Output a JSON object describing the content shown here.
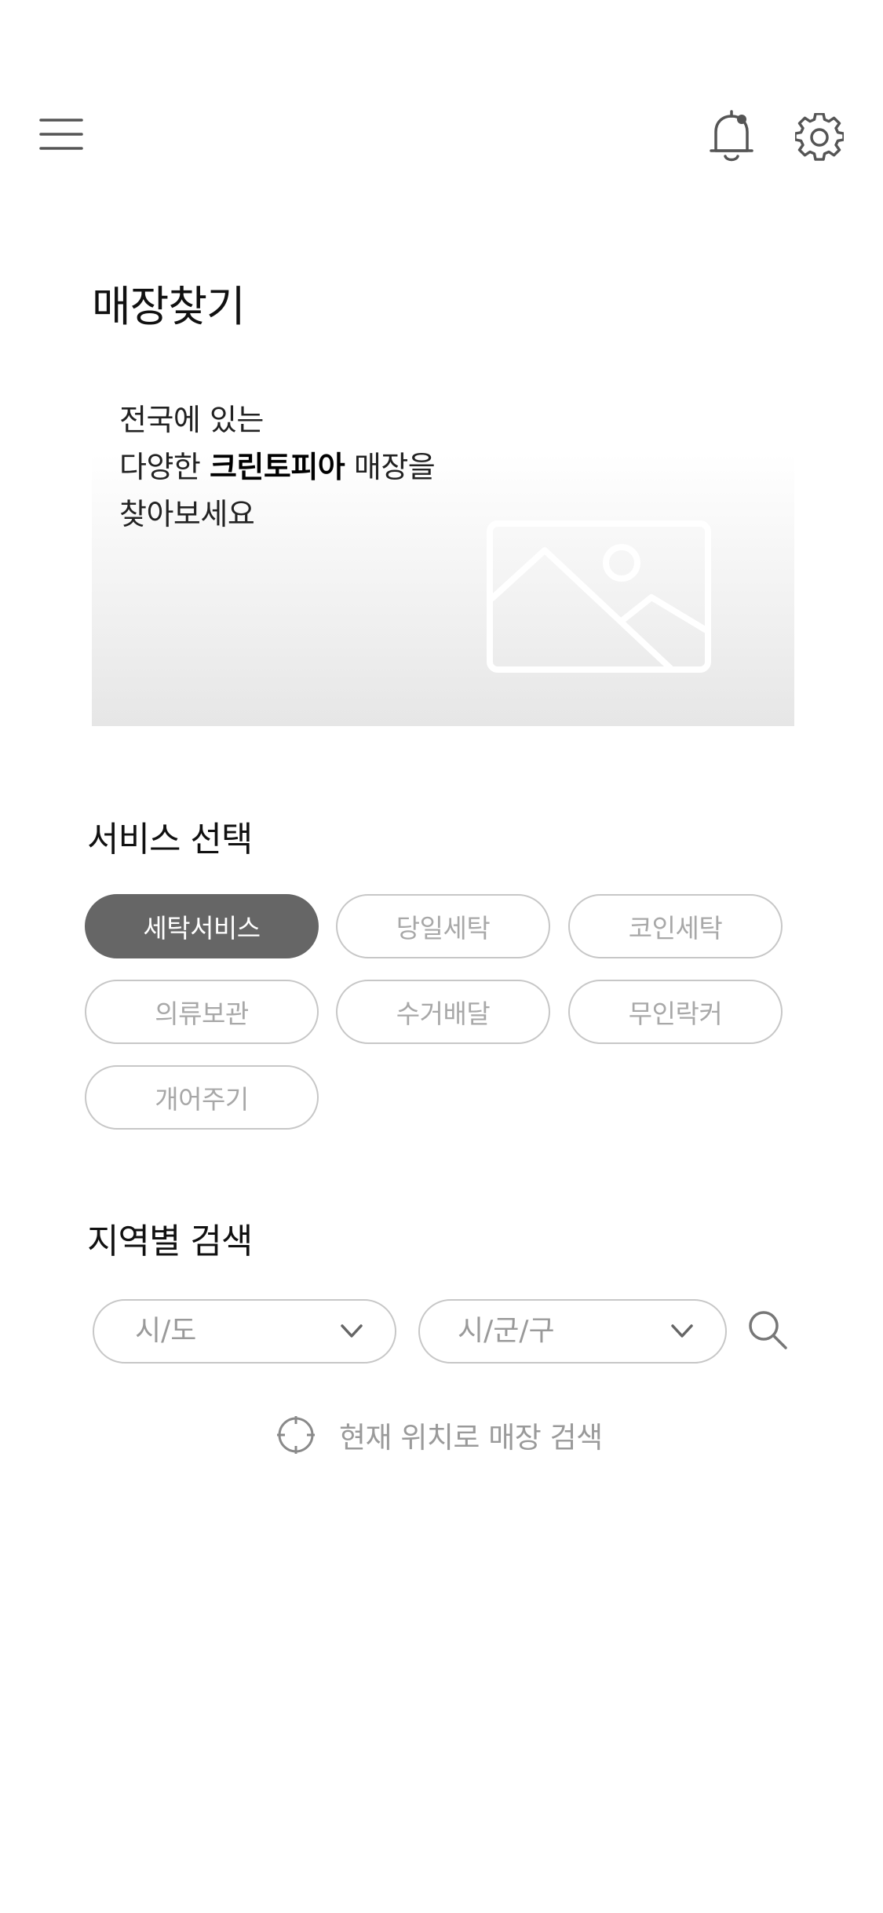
{
  "header": {
    "menu_icon": "hamburger-menu-icon",
    "notification_icon": "bell-icon",
    "settings_icon": "gear-icon"
  },
  "page": {
    "title": "매장찾기"
  },
  "banner": {
    "line1": "전국에 있는",
    "line2_prefix": "다양한 ",
    "line2_brand": "크린토피아",
    "line2_suffix": " 매장을",
    "line3": "찾아보세요",
    "image_icon": "image-placeholder-icon"
  },
  "services": {
    "title": "서비스 선택",
    "items": [
      {
        "label": "세탁서비스",
        "selected": true
      },
      {
        "label": "당일세탁",
        "selected": false
      },
      {
        "label": "코인세탁",
        "selected": false
      },
      {
        "label": "의류보관",
        "selected": false
      },
      {
        "label": "수거배달",
        "selected": false
      },
      {
        "label": "무인락커",
        "selected": false
      },
      {
        "label": "개어주기",
        "selected": false
      }
    ]
  },
  "region": {
    "title": "지역별 검색",
    "province_select": "시/도",
    "district_select": "시/군/구",
    "search_icon": "search-icon",
    "current_location_label": "현재 위치로 매장 검색",
    "location_icon": "crosshair-icon"
  },
  "colors": {
    "active_chip": "#666666",
    "chip_border": "#c7c7c7",
    "muted_text": "#a8a8a8"
  }
}
